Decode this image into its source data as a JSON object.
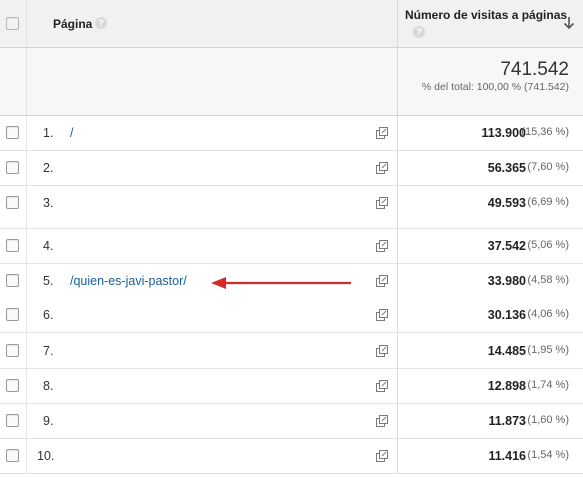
{
  "header": {
    "page_label": "Página",
    "metric_label": "Número de visitas a páginas",
    "help_glyph": "?"
  },
  "totals": {
    "value": "741.542",
    "subtitle": "% del total: 100,00 % (741.542)"
  },
  "rows": [
    {
      "rank": "1.",
      "page": "/",
      "value": "113.900",
      "pct": "(15,36 %)"
    },
    {
      "rank": "2.",
      "page": "",
      "value": "56.365",
      "pct": "(7,60 %)"
    },
    {
      "rank": "3.",
      "page": "",
      "value": "49.593",
      "pct": "(6,69 %)"
    },
    {
      "rank": "4.",
      "page": "",
      "value": "37.542",
      "pct": "(5,06 %)"
    },
    {
      "rank": "5.",
      "page": "/quien-es-javi-pastor/",
      "value": "33.980",
      "pct": "(4,58 %)"
    },
    {
      "rank": "6.",
      "page": "",
      "value": "30.136",
      "pct": "(4,06 %)"
    },
    {
      "rank": "7.",
      "page": "",
      "value": "14.485",
      "pct": "(1,95 %)"
    },
    {
      "rank": "8.",
      "page": "",
      "value": "12.898",
      "pct": "(1,74 %)"
    },
    {
      "rank": "9.",
      "page": "",
      "value": "11.873",
      "pct": "(1,60 %)"
    },
    {
      "rank": "10.",
      "page": "",
      "value": "11.416",
      "pct": "(1,54 %)"
    }
  ],
  "icons": {
    "sort": "arrow-down-icon",
    "open_page": "popout-icon",
    "annotation": "red-arrow"
  },
  "colors": {
    "link": "#1a5e9a",
    "annotation": "#d42a2a",
    "header_bg": "#f1f1f1"
  }
}
